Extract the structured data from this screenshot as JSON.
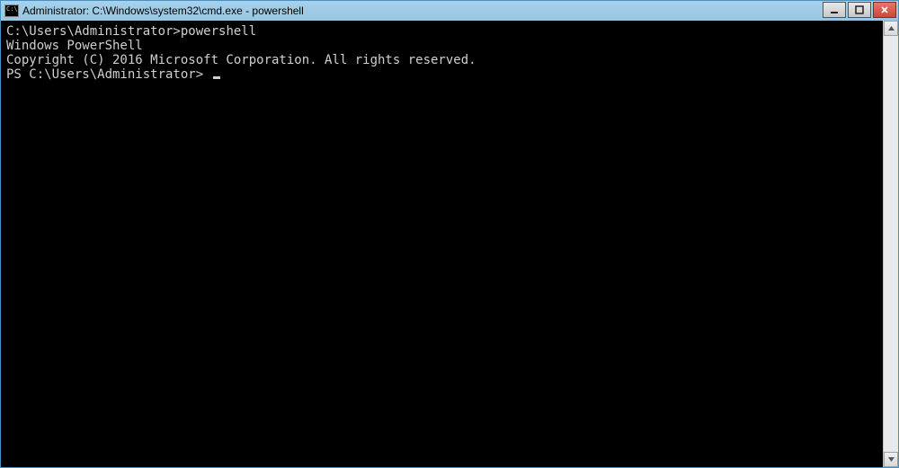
{
  "window": {
    "title": "Administrator: C:\\Windows\\system32\\cmd.exe - powershell"
  },
  "terminal": {
    "line1_prompt": "C:\\Users\\Administrator>",
    "line1_cmd": "powershell",
    "line2": "Windows PowerShell",
    "line3": "Copyright (C) 2016 Microsoft Corporation. All rights reserved.",
    "blank": "",
    "ps_prompt": "PS C:\\Users\\Administrator> "
  }
}
